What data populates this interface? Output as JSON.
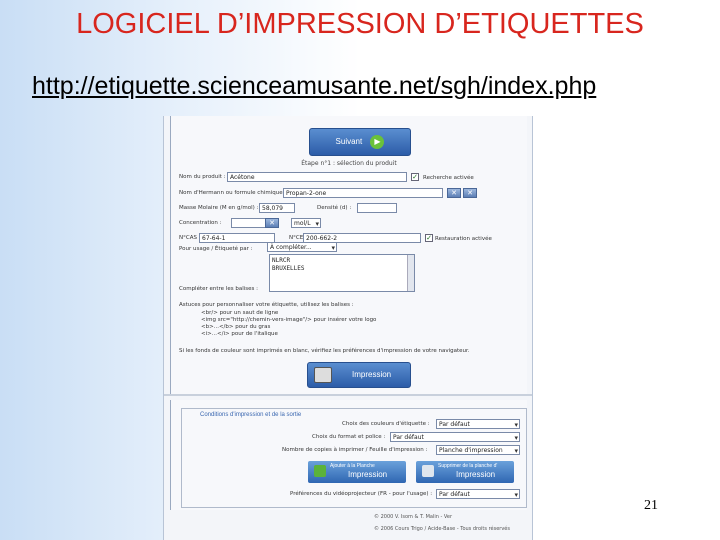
{
  "slide": {
    "title": "LOGICIEL D’IMPRESSION D’ETIQUETTES",
    "url": "http://etiquette.scienceamusante.net/sgh/index.php",
    "page_number": "21"
  },
  "screenshot": {
    "suivant_label": "Suivant",
    "header_text": "Étape n°1 : sélection du produit",
    "form": {
      "nom_du_produit_label": "Nom du produit :",
      "nom_du_produit_value": "Acétone",
      "recherche_active_label": "Recherche activée",
      "nom_formule_label": "Nom d'Hermann ou formule chimique :",
      "nom_formule_value": "Propan-2-one",
      "masse_molaire_label": "Masse Molaire (M en g/mol) :",
      "masse_molaire_value": "58,079",
      "densite_label": "Densité (d) :",
      "concentration_label": "Concentration :",
      "concentration_unit": "mol/L",
      "cas_label": "N°CAS :",
      "cas_value": "67-64-1",
      "ce_label": "N°CE :",
      "ce_value": "200-662-2",
      "restauration_label": "Restauration activée",
      "pour_label": "Pour usage / Étiqueté par :",
      "pour_value": "À compléter...",
      "textarea_value": "NLRCR\nBRUXELLES",
      "completer_label": "Compléter entre les balises :",
      "astuces_title": "Astuces pour personnaliser votre étiquette, utilisez les balises :",
      "astuces": [
        "<br/> pour un saut de ligne",
        "<img src=\"http://chemin-vers-image\"/> pour insérer votre logo",
        "<b>...</b> pour du gras",
        "<i>...</i> pour de l'italique"
      ],
      "note": "Si les fonds de couleur sont imprimés en blanc, vérifiez les préférences d'impression de votre navigateur."
    },
    "impression_label": "Impression",
    "options": {
      "legend": "Conditions d'impression et de la sortie",
      "couleurs_label": "Choix des couleurs d'étiquette :",
      "couleurs_value": "Par défaut",
      "format_label": "Choix du format et police :",
      "format_value": "Par défaut",
      "copies_label": "Nombre de copies à imprimer / Feuille d'impression :",
      "copies_value": "Planche d'impression",
      "ajouter_label": "Ajouter à la Planche",
      "ajouter_sub": "Impression",
      "supprimer_label": "Supprimer de la planche d'",
      "supprimer_sub": "Impression",
      "preferences_label": "Préférences du vidéoprojecteur (FR - pour l'usage) :",
      "preferences_value": "Par défaut"
    },
    "footer_1": "© 2000 V. Isom & T. Malin - Ver",
    "footer_2": "© 2006 Cours Trigo / Acide-Base - Tous droits réservés"
  }
}
